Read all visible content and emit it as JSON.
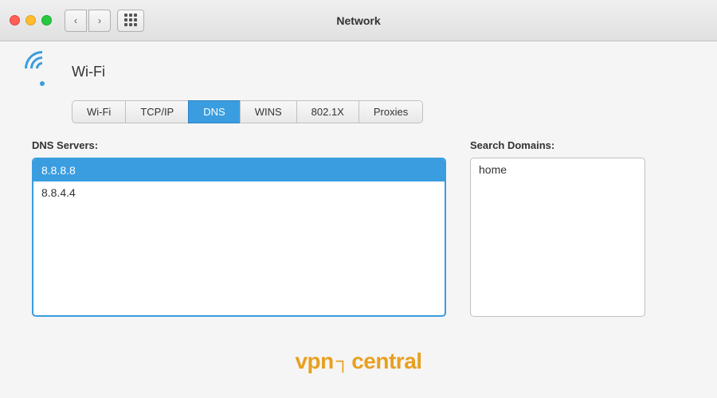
{
  "titlebar": {
    "title": "Network",
    "back_button": "‹",
    "forward_button": "›"
  },
  "wifi": {
    "label": "Wi-Fi"
  },
  "tabs": [
    {
      "id": "wifi",
      "label": "Wi-Fi",
      "active": false
    },
    {
      "id": "tcpip",
      "label": "TCP/IP",
      "active": false
    },
    {
      "id": "dns",
      "label": "DNS",
      "active": true
    },
    {
      "id": "wins",
      "label": "WINS",
      "active": false
    },
    {
      "id": "8021x",
      "label": "802.1X",
      "active": false
    },
    {
      "id": "proxies",
      "label": "Proxies",
      "active": false
    }
  ],
  "dns": {
    "servers_label": "DNS Servers:",
    "servers": [
      {
        "ip": "8.8.8.8",
        "selected": true
      },
      {
        "ip": "8.8.4.4",
        "selected": false
      }
    ],
    "search_domains_label": "Search Domains:",
    "search_domains": [
      {
        "domain": "home"
      }
    ]
  },
  "watermark": {
    "vpn": "vpn",
    "central": "central"
  }
}
